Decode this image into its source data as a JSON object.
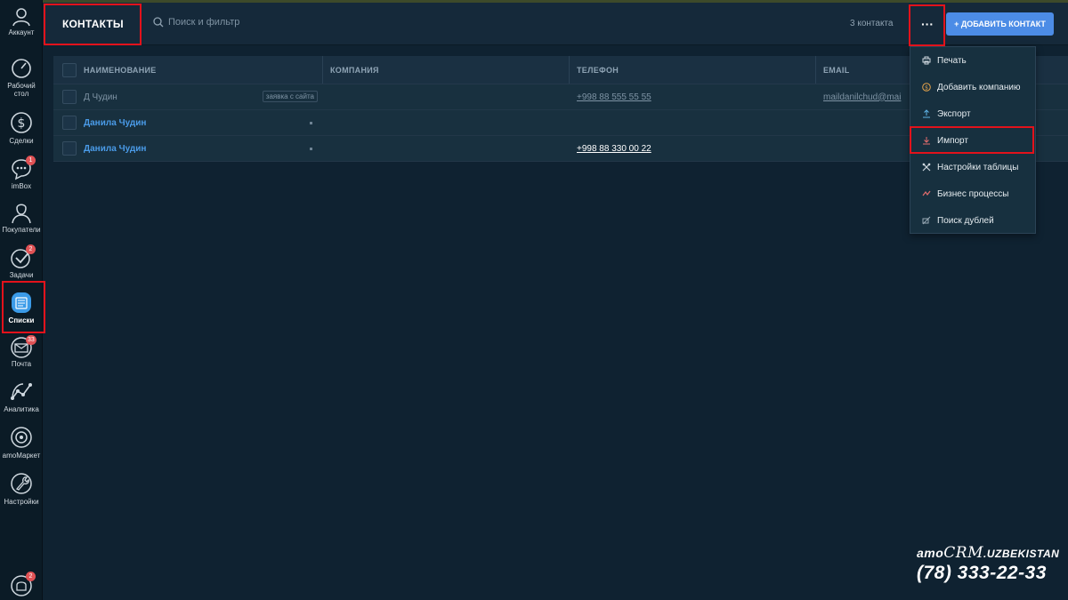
{
  "sidebar": {
    "account_label": "Аккаунт",
    "items": [
      {
        "label": "Рабочий\nстол",
        "icon": "speedometer-icon"
      },
      {
        "label": "Сделки",
        "icon": "dollar-icon"
      },
      {
        "label": "imBox",
        "icon": "chat-bubble-icon",
        "badge": "1"
      },
      {
        "label": "Покупатели",
        "icon": "user-silhouette-icon"
      },
      {
        "label": "Задачи",
        "icon": "checkmark-icon",
        "badge": "2"
      },
      {
        "label": "Списки",
        "icon": "list-icon",
        "active": true
      },
      {
        "label": "Почта",
        "icon": "envelope-icon",
        "badge": "33"
      },
      {
        "label": "Аналитика",
        "icon": "line-chart-icon"
      },
      {
        "label": "amoМаркет",
        "icon": "market-icon"
      },
      {
        "label": "Настройки",
        "icon": "wrench-icon"
      }
    ],
    "notifications_badge": "2"
  },
  "header": {
    "title": "КОНТАКТЫ",
    "search_placeholder": "Поиск и фильтр",
    "count": "3 контакта",
    "more_label": "···",
    "add_button": "+ ДОБАВИТЬ КОНТАКТ"
  },
  "table": {
    "columns": [
      "НАИМЕНОВАНИЕ",
      "КОМПАНИЯ",
      "ТЕЛЕФОН",
      "EMAIL"
    ],
    "rows": [
      {
        "name": "Д Чудин",
        "tag": "заявка с сайта",
        "company": "",
        "phone": "+998 88 555 55 55",
        "email": "maildanilchud@mai"
      },
      {
        "name": "Данила Чудин",
        "company": "",
        "phone": "",
        "email": ""
      },
      {
        "name": "Данила Чудин",
        "company": "",
        "phone": "+998 88 330 00 22",
        "email": ""
      }
    ]
  },
  "menu": {
    "items": [
      {
        "label": "Печать",
        "icon": "printer-icon"
      },
      {
        "label": "Добавить компанию",
        "icon": "company-icon"
      },
      {
        "label": "Экспорт",
        "icon": "upload-icon"
      },
      {
        "label": "Импорт",
        "icon": "download-icon"
      },
      {
        "label": "Настройки таблицы",
        "icon": "tools-icon"
      },
      {
        "label": "Бизнес процессы",
        "icon": "process-icon"
      },
      {
        "label": "Поиск дублей",
        "icon": "duplicates-icon"
      }
    ]
  },
  "brand": {
    "amo": "amo",
    "crm": "CRM",
    "uz": ".UZBEKISTAN",
    "phone": "(78) 333-22-33"
  },
  "colors": {
    "accent": "#4c8ce6",
    "link": "#4a9be8",
    "highlight": "#e3121b",
    "badge": "#e05255"
  }
}
